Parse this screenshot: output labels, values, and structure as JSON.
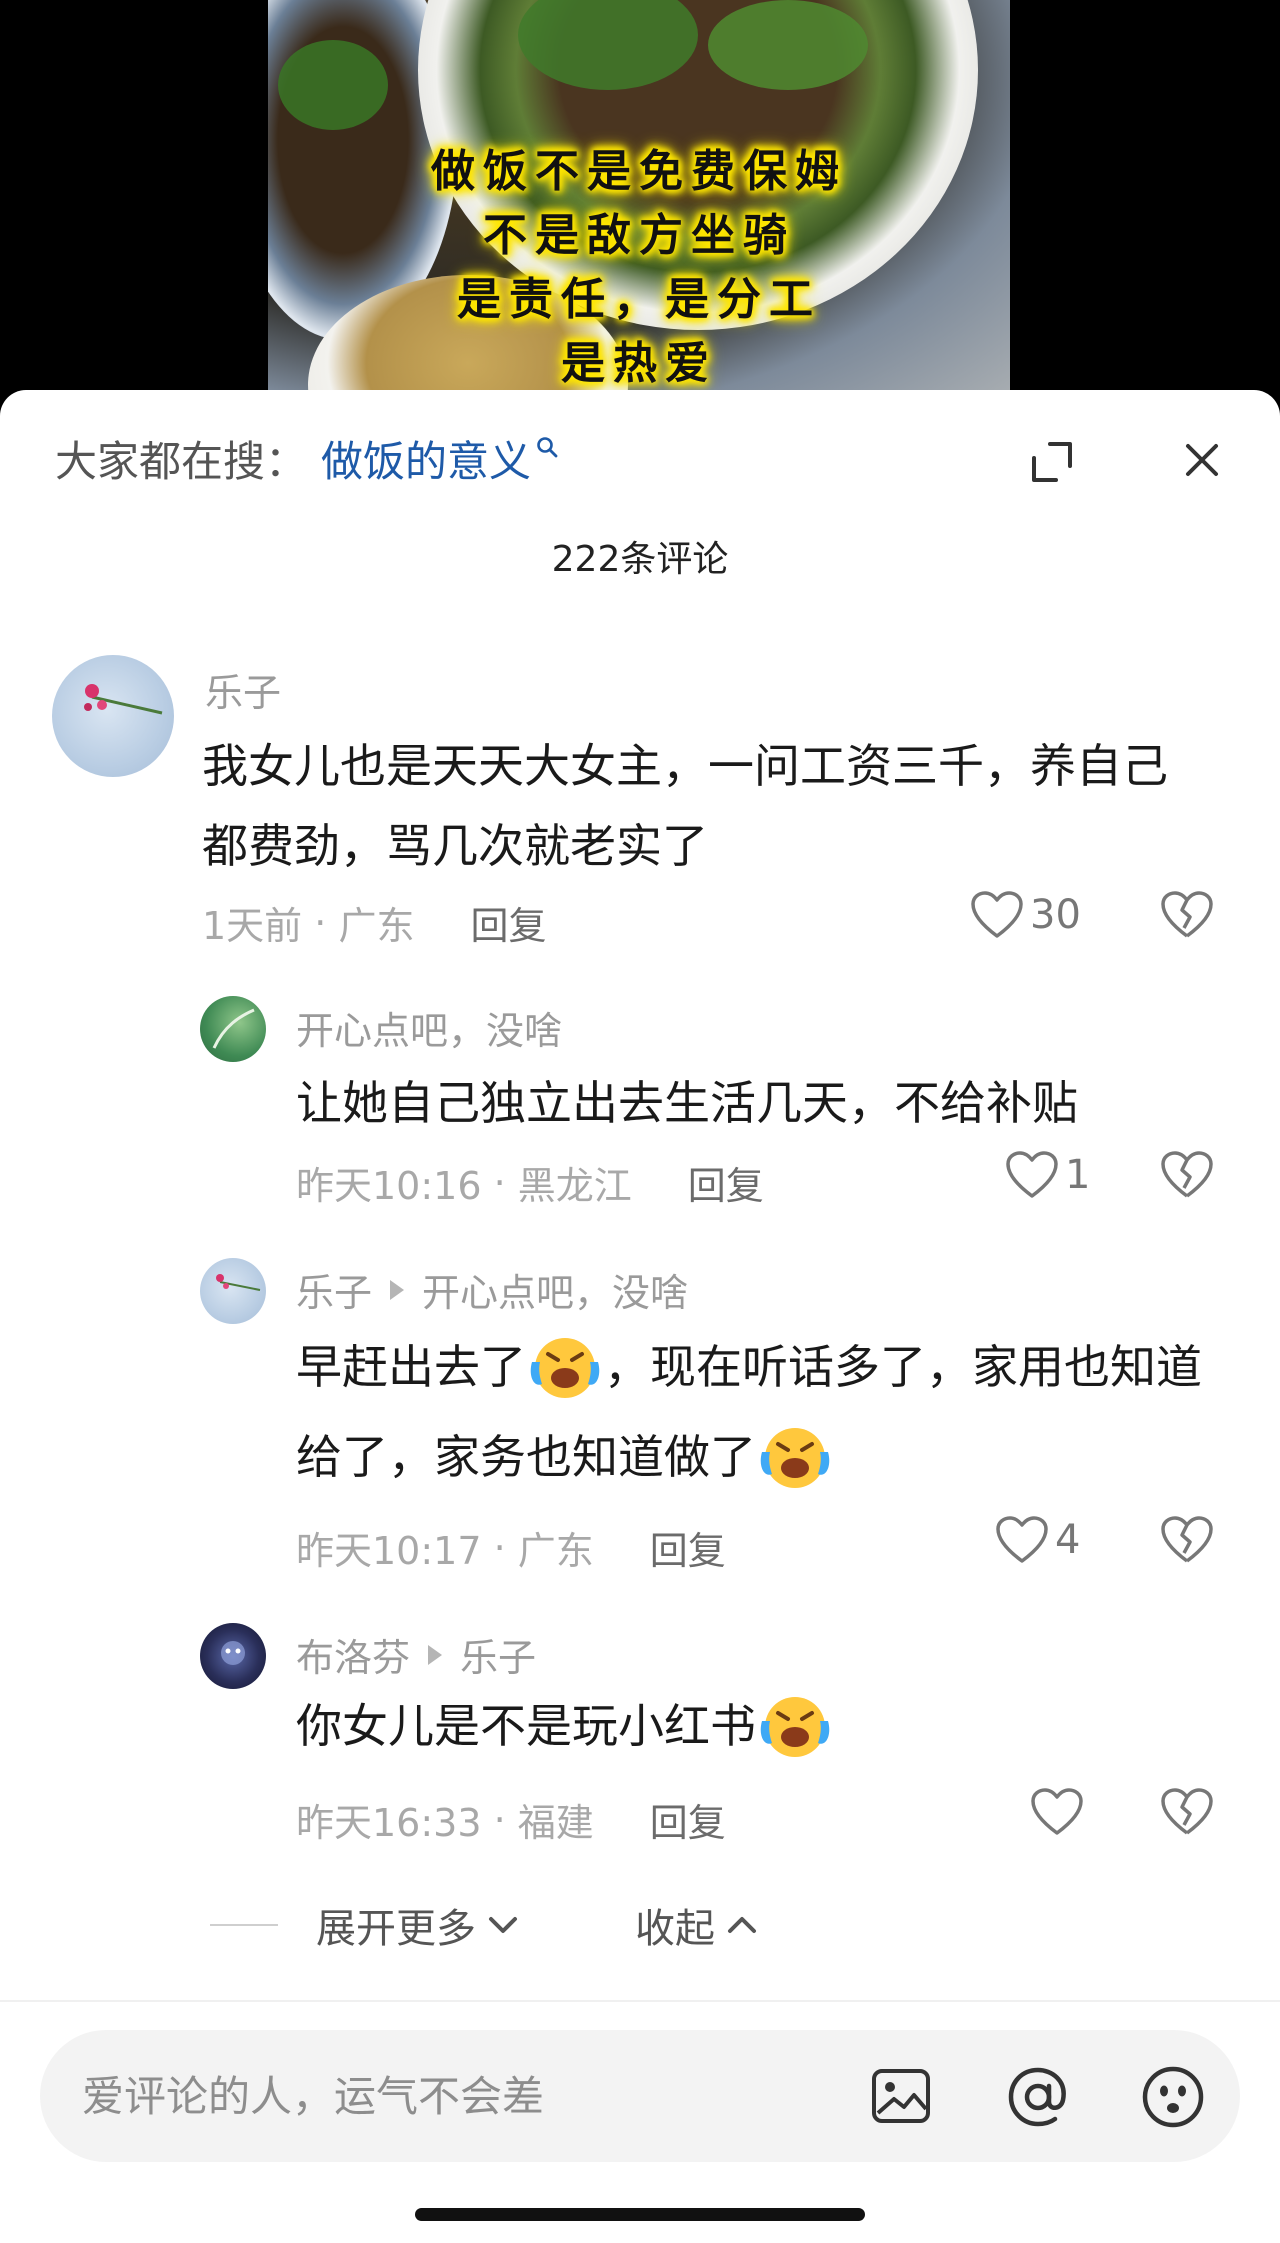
{
  "video": {
    "overlay_lines": [
      "做饭不是免费保姆",
      "不是敌方坐骑",
      "是责任，是分工",
      "是热爱"
    ]
  },
  "header": {
    "search_prefix": "大家都在搜：",
    "search_keyword": "做饭的意义",
    "comment_count": "222条评论"
  },
  "comments": [
    {
      "user": "乐子",
      "text": "我女儿也是天天大女主，一问工资三千，养自己都费劲，骂几次就老实了",
      "time": "1天前",
      "location": "广东",
      "reply_label": "回复",
      "likes": "30"
    }
  ],
  "replies": [
    {
      "user": "开心点吧，没啥",
      "text": "让她自己独立出去生活几天，不给补贴",
      "time": "昨天10:16",
      "location": "黑龙江",
      "reply_label": "回复",
      "likes": "1"
    },
    {
      "user": "乐子",
      "reply_to": "开心点吧，没啥",
      "text_part1": "早赶出去了",
      "text_part2": "，现在听话多了，家用也知道给了，家务也知道做了",
      "time": "昨天10:17",
      "location": "广东",
      "reply_label": "回复",
      "likes": "4"
    },
    {
      "user": "布洛芬",
      "reply_to": "乐子",
      "text": "你女儿是不是玩小红书",
      "time": "昨天16:33",
      "location": "福建",
      "reply_label": "回复",
      "likes": ""
    }
  ],
  "thread_controls": {
    "expand_more": "展开更多",
    "collapse": "收起"
  },
  "input": {
    "placeholder": "爱评论的人，运气不会差"
  },
  "colors": {
    "keyword_blue": "#1e5aa8",
    "meta_gray": "#a8a8a8",
    "overlay_glow": "#ffe600"
  },
  "icons": [
    "search-icon",
    "expand-icon",
    "close-icon",
    "heart-icon",
    "broken-heart-icon",
    "laughing-crying-emoji",
    "chevron-down-icon",
    "chevron-up-icon",
    "image-icon",
    "at-icon",
    "emoji-icon"
  ]
}
